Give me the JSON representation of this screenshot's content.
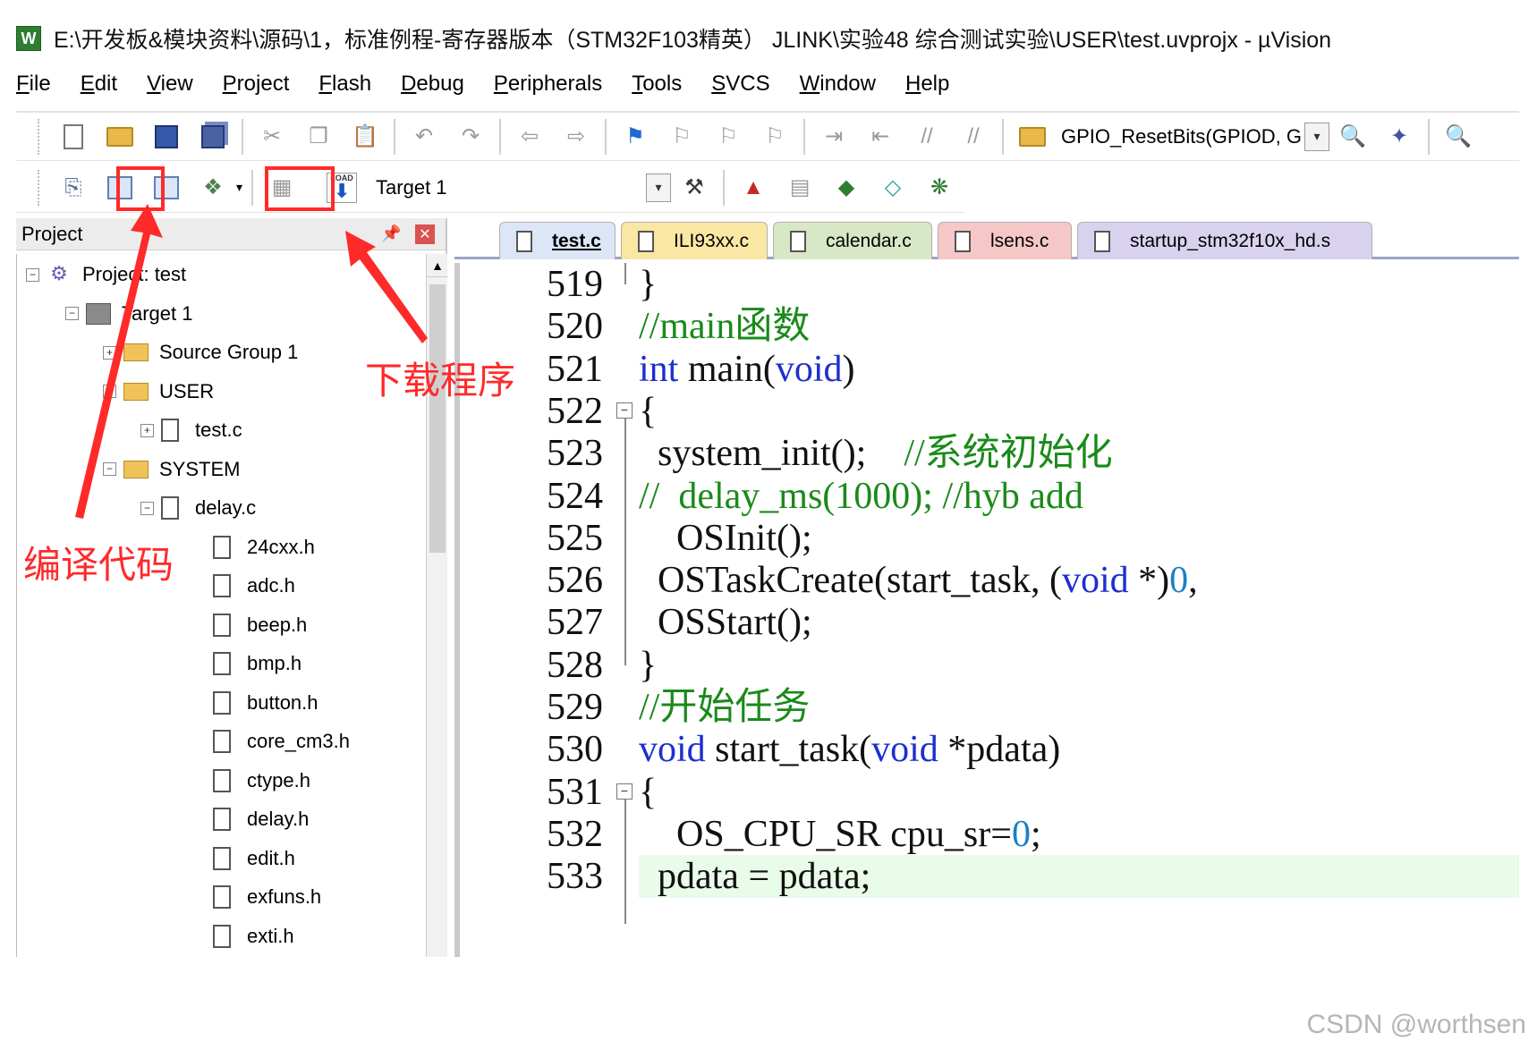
{
  "window": {
    "title": "E:\\开发板&模块资料\\源码\\1，标准例程-寄存器版本（STM32F103精英） JLINK\\实验48 综合测试实验\\USER\\test.uvprojx - µVision",
    "app_icon_letter": "W"
  },
  "menu": [
    "File",
    "Edit",
    "View",
    "Project",
    "Flash",
    "Debug",
    "Peripherals",
    "Tools",
    "SVCS",
    "Window",
    "Help"
  ],
  "toolbar": {
    "function_combo_value": "GPIO_ResetBits(GPIOD, G",
    "target_combo_value": "Target 1",
    "load_label": "LOAD"
  },
  "project_panel": {
    "title": "Project",
    "tree": [
      {
        "label": "Project: test",
        "depth": 0,
        "type": "project",
        "expander": "−"
      },
      {
        "label": "Target 1",
        "depth": 1,
        "type": "target",
        "expander": "−"
      },
      {
        "label": "Source Group 1",
        "depth": 2,
        "type": "folder",
        "expander": "+"
      },
      {
        "label": "USER",
        "depth": 2,
        "type": "folder",
        "expander": "−"
      },
      {
        "label": "test.c",
        "depth": 3,
        "type": "file",
        "expander": "+"
      },
      {
        "label": "SYSTEM",
        "depth": 2,
        "type": "folder",
        "expander": "−"
      },
      {
        "label": "delay.c",
        "depth": 3,
        "type": "file",
        "expander": "−"
      },
      {
        "label": "24cxx.h",
        "depth": 4,
        "type": "file"
      },
      {
        "label": "adc.h",
        "depth": 4,
        "type": "file"
      },
      {
        "label": "beep.h",
        "depth": 4,
        "type": "file"
      },
      {
        "label": "bmp.h",
        "depth": 4,
        "type": "file"
      },
      {
        "label": "button.h",
        "depth": 4,
        "type": "file"
      },
      {
        "label": "core_cm3.h",
        "depth": 4,
        "type": "file"
      },
      {
        "label": "ctype.h",
        "depth": 4,
        "type": "file"
      },
      {
        "label": "delay.h",
        "depth": 4,
        "type": "file"
      },
      {
        "label": "edit.h",
        "depth": 4,
        "type": "file"
      },
      {
        "label": "exfuns.h",
        "depth": 4,
        "type": "file"
      },
      {
        "label": "exti.h",
        "depth": 4,
        "type": "file"
      }
    ]
  },
  "editor": {
    "tabs": [
      {
        "label": "test.c",
        "color": "#dce6f7",
        "active": true
      },
      {
        "label": "ILI93xx.c",
        "color": "#fbe7a4",
        "active": false
      },
      {
        "label": "calendar.c",
        "color": "#d8e8c6",
        "active": false
      },
      {
        "label": "lsens.c",
        "color": "#f6c7c7",
        "active": false
      },
      {
        "label": "startup_stm32f10x_hd.s",
        "color": "#d9d2ef",
        "active": false
      }
    ],
    "lines": [
      {
        "num": "519",
        "segments": [
          {
            "t": "}",
            "c": ""
          }
        ]
      },
      {
        "num": "520",
        "segments": [
          {
            "t": "//main函数",
            "c": "cm"
          }
        ]
      },
      {
        "num": "521",
        "segments": [
          {
            "t": "int",
            "c": "kw"
          },
          {
            "t": " main(",
            "c": ""
          },
          {
            "t": "void",
            "c": "kw"
          },
          {
            "t": ")",
            "c": ""
          }
        ]
      },
      {
        "num": "522",
        "segments": [
          {
            "t": "{",
            "c": ""
          }
        ]
      },
      {
        "num": "523",
        "segments": [
          {
            "t": "  system_init();    ",
            "c": ""
          },
          {
            "t": "//系统初始化",
            "c": "cm"
          }
        ]
      },
      {
        "num": "524",
        "segments": [
          {
            "t": "//  delay_ms(1000); //hyb add",
            "c": "cm"
          }
        ]
      },
      {
        "num": "525",
        "segments": [
          {
            "t": "    OSInit();",
            "c": ""
          }
        ]
      },
      {
        "num": "526",
        "segments": [
          {
            "t": "  OSTaskCreate(start_task, (",
            "c": ""
          },
          {
            "t": "void",
            "c": "kw"
          },
          {
            "t": " *)",
            "c": ""
          },
          {
            "t": "0",
            "c": "nm"
          },
          {
            "t": ",",
            "c": ""
          }
        ]
      },
      {
        "num": "527",
        "segments": [
          {
            "t": "  OSStart();",
            "c": ""
          }
        ]
      },
      {
        "num": "528",
        "segments": [
          {
            "t": "}",
            "c": ""
          }
        ]
      },
      {
        "num": "529",
        "segments": [
          {
            "t": "//开始任务",
            "c": "cm"
          }
        ]
      },
      {
        "num": "530",
        "segments": [
          {
            "t": "void",
            "c": "kw"
          },
          {
            "t": " start_task(",
            "c": ""
          },
          {
            "t": "void",
            "c": "kw"
          },
          {
            "t": " *pdata)",
            "c": ""
          }
        ]
      },
      {
        "num": "531",
        "segments": [
          {
            "t": "{",
            "c": ""
          }
        ]
      },
      {
        "num": "532",
        "segments": [
          {
            "t": "    OS_CPU_SR cpu_sr=",
            "c": ""
          },
          {
            "t": "0",
            "c": "nm"
          },
          {
            "t": ";",
            "c": ""
          }
        ]
      },
      {
        "num": "533",
        "segments": [
          {
            "t": "  pdata = pdata;",
            "c": ""
          }
        ]
      }
    ]
  },
  "annotations": {
    "compile_label": "编译代码",
    "download_label": "下载程序",
    "color": "#ff2a2a"
  },
  "watermark": "CSDN @worthsen"
}
